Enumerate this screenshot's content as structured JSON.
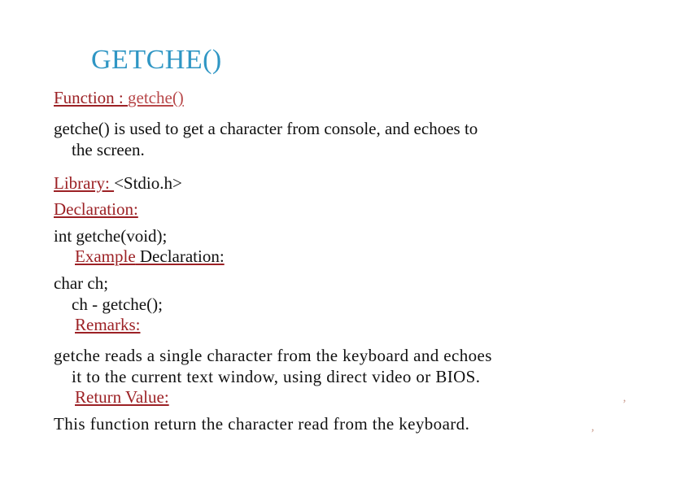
{
  "slide": {
    "title": "GETCHE()",
    "title_color": "#2f96c4",
    "background_color": "#ffffff",
    "heading_color": "#9c2125",
    "body_color": "#111111"
  },
  "content": {
    "function_label": "Function : ",
    "function_name": "getche()",
    "description_line1": "getche() is used to get a character from console, and echoes to",
    "description_line2": "the screen.",
    "library_label": "Library: ",
    "library_value": "<Stdio.h>",
    "declaration_label": "Declaration:",
    "declaration_code": "int getche(void);",
    "example_label_red": "Example",
    "example_label_black": " Declaration:",
    "example_code_line1": "char ch;",
    "example_code_line2": "ch -  getche();",
    "remarks_label": "Remarks:",
    "remarks_line1": "getche reads a single character  from the  keyboard and echoes",
    "remarks_line2": "it to the current text window, using direct video or BIOS.",
    "return_value_label": "Return Value:",
    "return_value_text": "This function return the character  read from the  keyboard."
  },
  "artifacts": {
    "mark_one": "’",
    "mark_two": "’"
  }
}
